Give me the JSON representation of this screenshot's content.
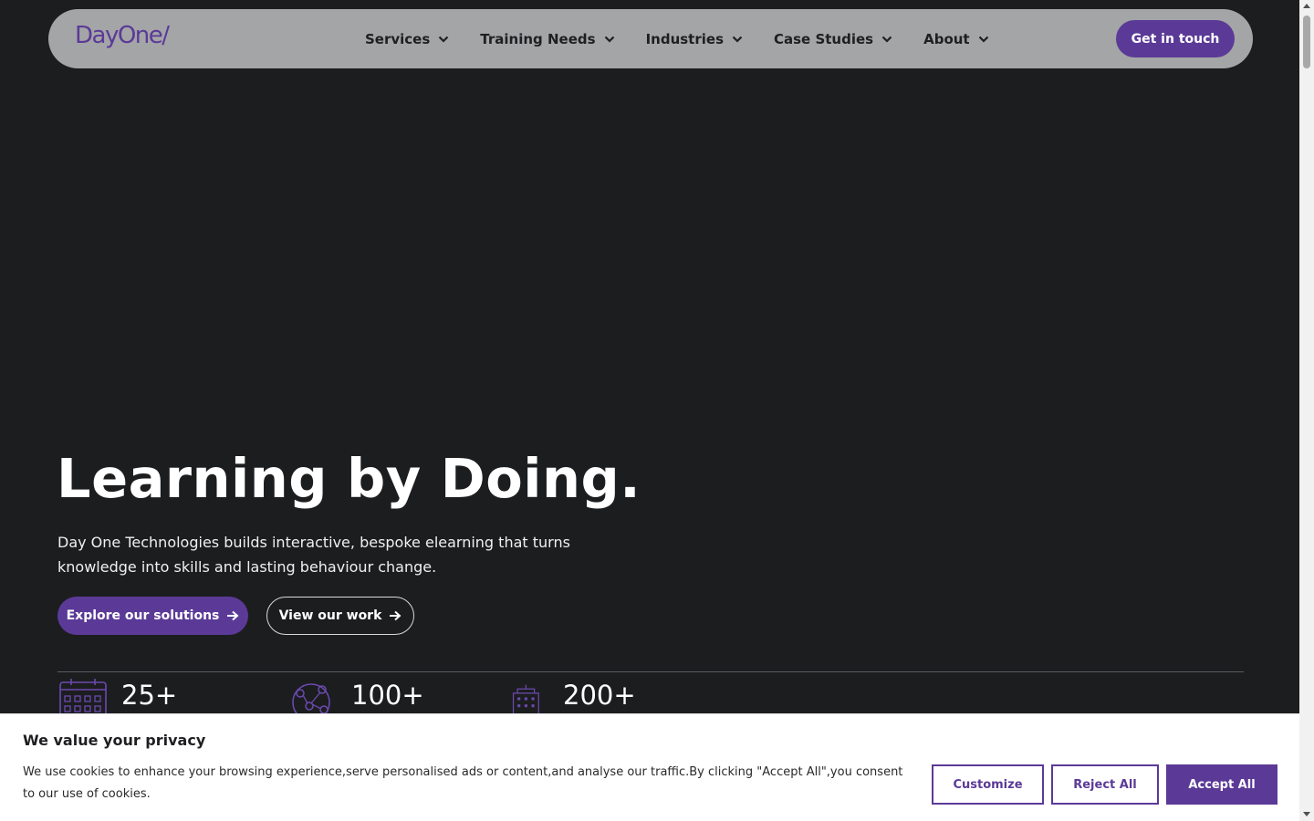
{
  "nav": {
    "logo": "DayOne/",
    "items": [
      {
        "label": "Services"
      },
      {
        "label": "Training Needs"
      },
      {
        "label": "Industries"
      },
      {
        "label": "Case Studies"
      },
      {
        "label": "About"
      }
    ],
    "cta_label": "Get in touch"
  },
  "hero": {
    "title": "Learning by Doing.",
    "description": "Day One Technologies builds interactive, bespoke elearning that turns knowledge into skills and lasting behaviour change.",
    "primary_button": "Explore our solutions",
    "secondary_button": "View our work"
  },
  "stats": [
    {
      "value": "25+",
      "icon": "calendar-icon"
    },
    {
      "value": "100+",
      "icon": "globe-network-icon"
    },
    {
      "value": "200+",
      "icon": "building-icon"
    }
  ],
  "cookie": {
    "title": "We value your privacy",
    "text": "We use cookies to enhance your browsing experience,serve personalised ads or content,and analyse our traffic.By clicking \"Accept All\",you consent to our use of cookies.",
    "customize_label": "Customize",
    "reject_label": "Reject All",
    "accept_label": "Accept All"
  },
  "colors": {
    "brand_purple": "#5b3a97",
    "background": "#1c1d1f",
    "nav_bg": "#a4a5a7"
  }
}
